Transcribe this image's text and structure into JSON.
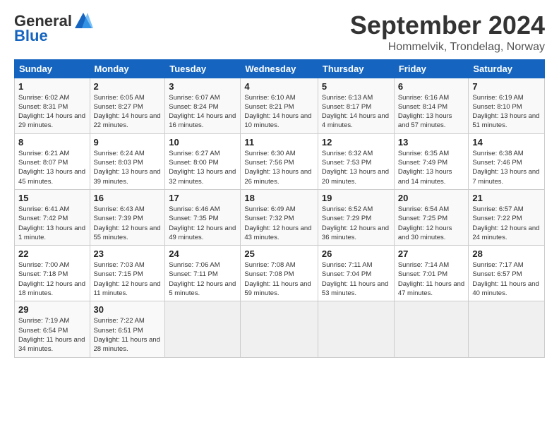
{
  "header": {
    "logo_general": "General",
    "logo_blue": "Blue",
    "month_title": "September 2024",
    "location": "Hommelvik, Trondelag, Norway"
  },
  "days_of_week": [
    "Sunday",
    "Monday",
    "Tuesday",
    "Wednesday",
    "Thursday",
    "Friday",
    "Saturday"
  ],
  "weeks": [
    [
      {
        "day": "1",
        "sunrise": "Sunrise: 6:02 AM",
        "sunset": "Sunset: 8:31 PM",
        "daylight": "Daylight: 14 hours and 29 minutes."
      },
      {
        "day": "2",
        "sunrise": "Sunrise: 6:05 AM",
        "sunset": "Sunset: 8:27 PM",
        "daylight": "Daylight: 14 hours and 22 minutes."
      },
      {
        "day": "3",
        "sunrise": "Sunrise: 6:07 AM",
        "sunset": "Sunset: 8:24 PM",
        "daylight": "Daylight: 14 hours and 16 minutes."
      },
      {
        "day": "4",
        "sunrise": "Sunrise: 6:10 AM",
        "sunset": "Sunset: 8:21 PM",
        "daylight": "Daylight: 14 hours and 10 minutes."
      },
      {
        "day": "5",
        "sunrise": "Sunrise: 6:13 AM",
        "sunset": "Sunset: 8:17 PM",
        "daylight": "Daylight: 14 hours and 4 minutes."
      },
      {
        "day": "6",
        "sunrise": "Sunrise: 6:16 AM",
        "sunset": "Sunset: 8:14 PM",
        "daylight": "Daylight: 13 hours and 57 minutes."
      },
      {
        "day": "7",
        "sunrise": "Sunrise: 6:19 AM",
        "sunset": "Sunset: 8:10 PM",
        "daylight": "Daylight: 13 hours and 51 minutes."
      }
    ],
    [
      {
        "day": "8",
        "sunrise": "Sunrise: 6:21 AM",
        "sunset": "Sunset: 8:07 PM",
        "daylight": "Daylight: 13 hours and 45 minutes."
      },
      {
        "day": "9",
        "sunrise": "Sunrise: 6:24 AM",
        "sunset": "Sunset: 8:03 PM",
        "daylight": "Daylight: 13 hours and 39 minutes."
      },
      {
        "day": "10",
        "sunrise": "Sunrise: 6:27 AM",
        "sunset": "Sunset: 8:00 PM",
        "daylight": "Daylight: 13 hours and 32 minutes."
      },
      {
        "day": "11",
        "sunrise": "Sunrise: 6:30 AM",
        "sunset": "Sunset: 7:56 PM",
        "daylight": "Daylight: 13 hours and 26 minutes."
      },
      {
        "day": "12",
        "sunrise": "Sunrise: 6:32 AM",
        "sunset": "Sunset: 7:53 PM",
        "daylight": "Daylight: 13 hours and 20 minutes."
      },
      {
        "day": "13",
        "sunrise": "Sunrise: 6:35 AM",
        "sunset": "Sunset: 7:49 PM",
        "daylight": "Daylight: 13 hours and 14 minutes."
      },
      {
        "day": "14",
        "sunrise": "Sunrise: 6:38 AM",
        "sunset": "Sunset: 7:46 PM",
        "daylight": "Daylight: 13 hours and 7 minutes."
      }
    ],
    [
      {
        "day": "15",
        "sunrise": "Sunrise: 6:41 AM",
        "sunset": "Sunset: 7:42 PM",
        "daylight": "Daylight: 13 hours and 1 minute."
      },
      {
        "day": "16",
        "sunrise": "Sunrise: 6:43 AM",
        "sunset": "Sunset: 7:39 PM",
        "daylight": "Daylight: 12 hours and 55 minutes."
      },
      {
        "day": "17",
        "sunrise": "Sunrise: 6:46 AM",
        "sunset": "Sunset: 7:35 PM",
        "daylight": "Daylight: 12 hours and 49 minutes."
      },
      {
        "day": "18",
        "sunrise": "Sunrise: 6:49 AM",
        "sunset": "Sunset: 7:32 PM",
        "daylight": "Daylight: 12 hours and 43 minutes."
      },
      {
        "day": "19",
        "sunrise": "Sunrise: 6:52 AM",
        "sunset": "Sunset: 7:29 PM",
        "daylight": "Daylight: 12 hours and 36 minutes."
      },
      {
        "day": "20",
        "sunrise": "Sunrise: 6:54 AM",
        "sunset": "Sunset: 7:25 PM",
        "daylight": "Daylight: 12 hours and 30 minutes."
      },
      {
        "day": "21",
        "sunrise": "Sunrise: 6:57 AM",
        "sunset": "Sunset: 7:22 PM",
        "daylight": "Daylight: 12 hours and 24 minutes."
      }
    ],
    [
      {
        "day": "22",
        "sunrise": "Sunrise: 7:00 AM",
        "sunset": "Sunset: 7:18 PM",
        "daylight": "Daylight: 12 hours and 18 minutes."
      },
      {
        "day": "23",
        "sunrise": "Sunrise: 7:03 AM",
        "sunset": "Sunset: 7:15 PM",
        "daylight": "Daylight: 12 hours and 11 minutes."
      },
      {
        "day": "24",
        "sunrise": "Sunrise: 7:06 AM",
        "sunset": "Sunset: 7:11 PM",
        "daylight": "Daylight: 12 hours and 5 minutes."
      },
      {
        "day": "25",
        "sunrise": "Sunrise: 7:08 AM",
        "sunset": "Sunset: 7:08 PM",
        "daylight": "Daylight: 11 hours and 59 minutes."
      },
      {
        "day": "26",
        "sunrise": "Sunrise: 7:11 AM",
        "sunset": "Sunset: 7:04 PM",
        "daylight": "Daylight: 11 hours and 53 minutes."
      },
      {
        "day": "27",
        "sunrise": "Sunrise: 7:14 AM",
        "sunset": "Sunset: 7:01 PM",
        "daylight": "Daylight: 11 hours and 47 minutes."
      },
      {
        "day": "28",
        "sunrise": "Sunrise: 7:17 AM",
        "sunset": "Sunset: 6:57 PM",
        "daylight": "Daylight: 11 hours and 40 minutes."
      }
    ],
    [
      {
        "day": "29",
        "sunrise": "Sunrise: 7:19 AM",
        "sunset": "Sunset: 6:54 PM",
        "daylight": "Daylight: 11 hours and 34 minutes."
      },
      {
        "day": "30",
        "sunrise": "Sunrise: 7:22 AM",
        "sunset": "Sunset: 6:51 PM",
        "daylight": "Daylight: 11 hours and 28 minutes."
      },
      null,
      null,
      null,
      null,
      null
    ]
  ]
}
